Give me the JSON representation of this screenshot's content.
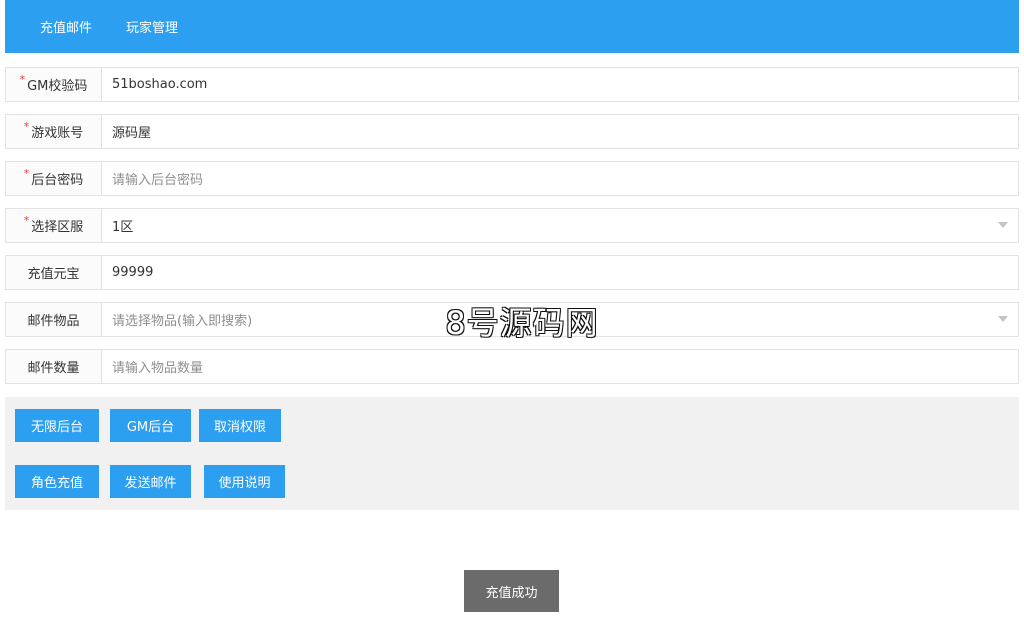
{
  "nav": {
    "tabs": [
      "充值邮件",
      "玩家管理"
    ]
  },
  "form": {
    "rows": [
      {
        "label": "GM校验码",
        "required": "*",
        "value": "51boshao.com"
      },
      {
        "label": "游戏账号",
        "required": "*",
        "value": "源码屋"
      },
      {
        "label": "后台密码",
        "required": "*",
        "placeholder": "请输入后台密码"
      },
      {
        "label": "选择区服",
        "required": "*",
        "value": "1区"
      },
      {
        "label": "充值元宝",
        "value": "99999"
      },
      {
        "label": "邮件物品",
        "placeholder": "请选择物品(输入即搜索)"
      },
      {
        "label": "邮件数量",
        "placeholder": "请输入物品数量"
      }
    ]
  },
  "buttons": {
    "row1": [
      "无限后台",
      "GM后台",
      "取消权限"
    ],
    "row2": [
      "角色充值",
      "发送邮件",
      "使用说明"
    ]
  },
  "status": {
    "success": "充值成功"
  },
  "watermark": {
    "text": "8号源码网",
    "image_alt": "源码屋 watermark logo"
  },
  "colors": {
    "header": "#2d9ff0",
    "button": "#2d9ff0",
    "success_bg": "#6b6b6b",
    "required": "#e23c3c"
  }
}
